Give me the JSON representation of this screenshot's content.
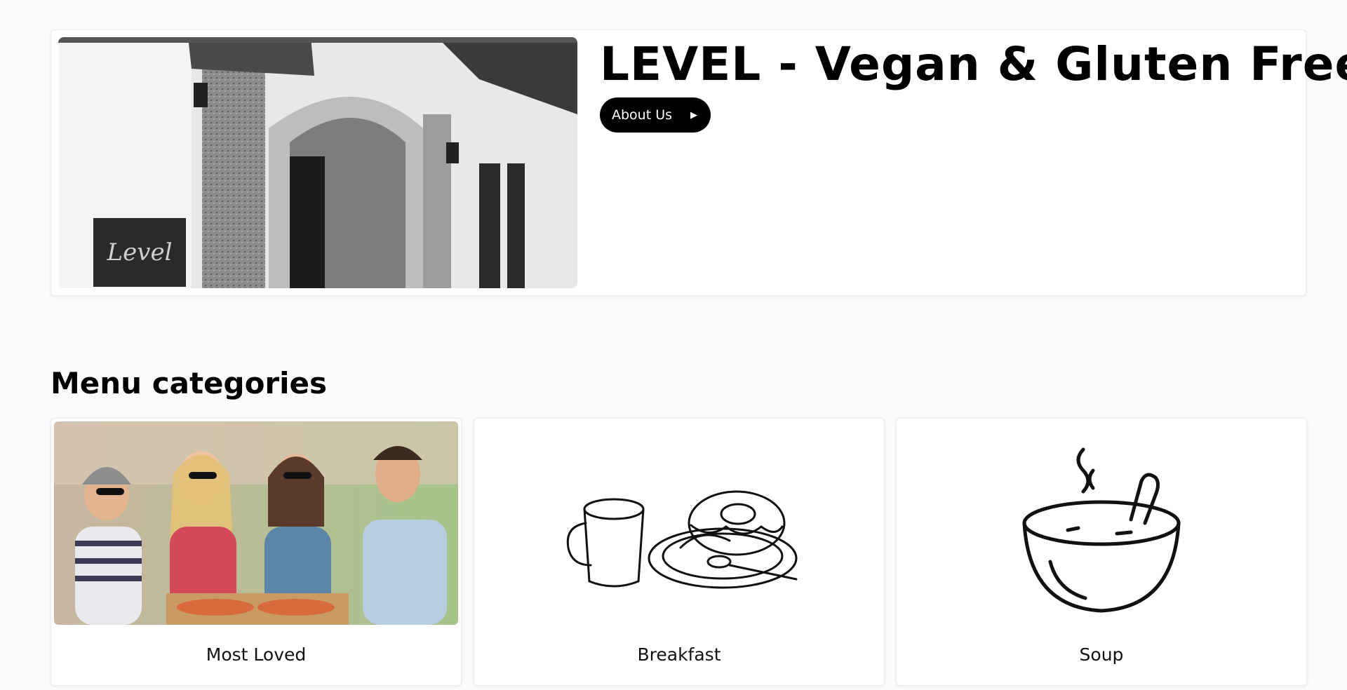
{
  "hero": {
    "title": "LEVEL - Vegan & Gluten Free",
    "about_button": "About Us",
    "about_caret": "▶",
    "sign_text": "Level"
  },
  "menu": {
    "heading": "Menu categories",
    "categories": [
      {
        "label": "Most Loved",
        "image": "friends-eating-pizza-photo"
      },
      {
        "label": "Breakfast",
        "image": "coffee-and-donut-icon"
      },
      {
        "label": "Soup",
        "image": "soup-bowl-icon"
      }
    ]
  },
  "colors": {
    "button_bg": "#000000",
    "button_text": "#ffffff",
    "page_bg": "#fbfbfb"
  }
}
